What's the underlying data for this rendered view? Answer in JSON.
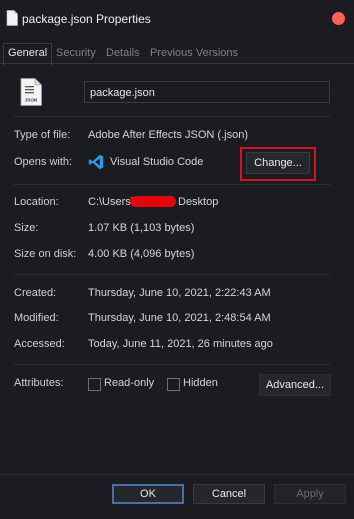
{
  "window": {
    "title": "package.json Properties",
    "close_color": "#ff5f57"
  },
  "tabs": [
    {
      "label": "General",
      "active": true
    },
    {
      "label": "Security",
      "active": false
    },
    {
      "label": "Details",
      "active": false
    },
    {
      "label": "Previous Versions",
      "active": false
    }
  ],
  "file": {
    "icon_label": "JSON",
    "name": "package.json"
  },
  "general": {
    "type_label": "Type of file:",
    "type_value": "Adobe After Effects JSON (.json)",
    "opens_label": "Opens with:",
    "opens_value": "Visual Studio Code",
    "change_label": "Change...",
    "location_label": "Location:",
    "location_prefix": "C:\\Users\\",
    "location_suffix": "Desktop",
    "size_label": "Size:",
    "size_value": "1.07 KB (1,103 bytes)",
    "size_disk_label": "Size on disk:",
    "size_disk_value": "4.00 KB (4,096 bytes)",
    "created_label": "Created:",
    "created_value": "Thursday, June 10, 2021, 2:22:43 AM",
    "modified_label": "Modified:",
    "modified_value": "Thursday, June 10, 2021, 2:48:54 AM",
    "accessed_label": "Accessed:",
    "accessed_value": "Today, June 11, 2021, 26 minutes ago",
    "attributes_label": "Attributes:",
    "readonly_label": "Read-only",
    "hidden_label": "Hidden",
    "advanced_label": "Advanced..."
  },
  "footer": {
    "ok_label": "OK",
    "cancel_label": "Cancel",
    "apply_label": "Apply"
  },
  "colors": {
    "background": "#1b1c21",
    "highlight_box": "#d6121a",
    "redaction": "#e5060c",
    "vscode_blue": "#2f9ae0"
  }
}
